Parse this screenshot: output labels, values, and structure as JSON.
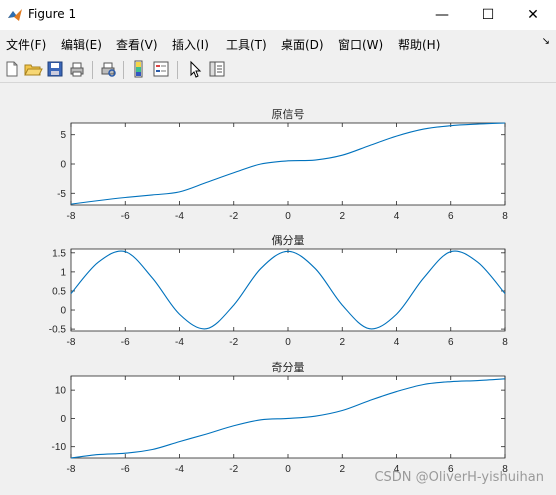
{
  "window": {
    "title": "Figure 1"
  },
  "window_controls": {
    "minimize": "—",
    "maximize": "☐",
    "close": "✕"
  },
  "menu": {
    "items": [
      {
        "label": "文件(F)"
      },
      {
        "label": "编辑(E)"
      },
      {
        "label": "查看(V)"
      },
      {
        "label": "插入(I)"
      },
      {
        "label": "工具(T)"
      },
      {
        "label": "桌面(D)"
      },
      {
        "label": "窗口(W)"
      },
      {
        "label": "帮助(H)"
      }
    ],
    "overflow": "↘"
  },
  "toolbar": {
    "icons": [
      "new-figure-icon",
      "open-file-icon",
      "save-icon",
      "print-icon",
      "print-preview-icon",
      "insert-colorbar-icon",
      "insert-legend-icon",
      "edit-plot-arrow-icon",
      "property-inspector-icon"
    ]
  },
  "chart_data": [
    {
      "type": "line",
      "title": "原信号",
      "xlim": [
        -8,
        8
      ],
      "ylim": [
        -7,
        7
      ],
      "xticks": [
        -8,
        -6,
        -4,
        -2,
        0,
        2,
        4,
        6,
        8
      ],
      "yticks": [
        -5,
        0,
        5
      ],
      "series": [
        {
          "x": [
            -8,
            -7,
            -6,
            -5,
            -4,
            -3,
            -2,
            -1,
            0,
            1,
            2,
            3,
            4,
            5,
            6,
            7,
            8
          ],
          "y": [
            -6.85,
            -6.25,
            -5.72,
            -5.28,
            -4.76,
            -3.14,
            -1.5,
            0.0,
            0.54,
            0.68,
            1.5,
            3.14,
            4.76,
            5.96,
            6.55,
            6.82,
            7.0
          ]
        }
      ],
      "color": "#0072BD"
    },
    {
      "type": "line",
      "title": "偶分量",
      "xlim": [
        -8,
        8
      ],
      "ylim": [
        -0.55,
        1.6
      ],
      "xticks": [
        -8,
        -6,
        -4,
        -2,
        0,
        2,
        4,
        6,
        8
      ],
      "yticks": [
        -0.5,
        0,
        0.5,
        1,
        1.5
      ],
      "series": [
        {
          "x": [
            -8,
            -7,
            -6,
            -5,
            -4,
            -3,
            -2,
            -1,
            0,
            1,
            2,
            3,
            4,
            5,
            6,
            7,
            8
          ],
          "y": [
            0.43,
            1.25,
            1.53,
            0.84,
            -0.11,
            -0.49,
            0.13,
            1.09,
            1.54,
            1.09,
            0.13,
            -0.49,
            -0.11,
            0.84,
            1.53,
            1.25,
            0.43
          ]
        }
      ],
      "color": "#0072BD"
    },
    {
      "type": "line",
      "title": "奇分量",
      "xlim": [
        -8,
        8
      ],
      "ylim": [
        -14,
        15
      ],
      "xticks": [
        -8,
        -6,
        -4,
        -2,
        0,
        2,
        4,
        6,
        8
      ],
      "yticks": [
        -10,
        0,
        10
      ],
      "series": [
        {
          "x": [
            -8,
            -7,
            -6,
            -5,
            -4,
            -3,
            -2,
            -1,
            0,
            1,
            2,
            3,
            4,
            5,
            6,
            7,
            8
          ],
          "y": [
            -14.0,
            -12.8,
            -12.3,
            -11.0,
            -8.2,
            -5.5,
            -2.6,
            -0.5,
            0.0,
            0.8,
            2.8,
            6.3,
            9.5,
            12.0,
            13.0,
            13.4,
            14.0
          ]
        }
      ],
      "color": "#0072BD"
    }
  ],
  "watermark": "CSDN @OliverH-yishuihan"
}
